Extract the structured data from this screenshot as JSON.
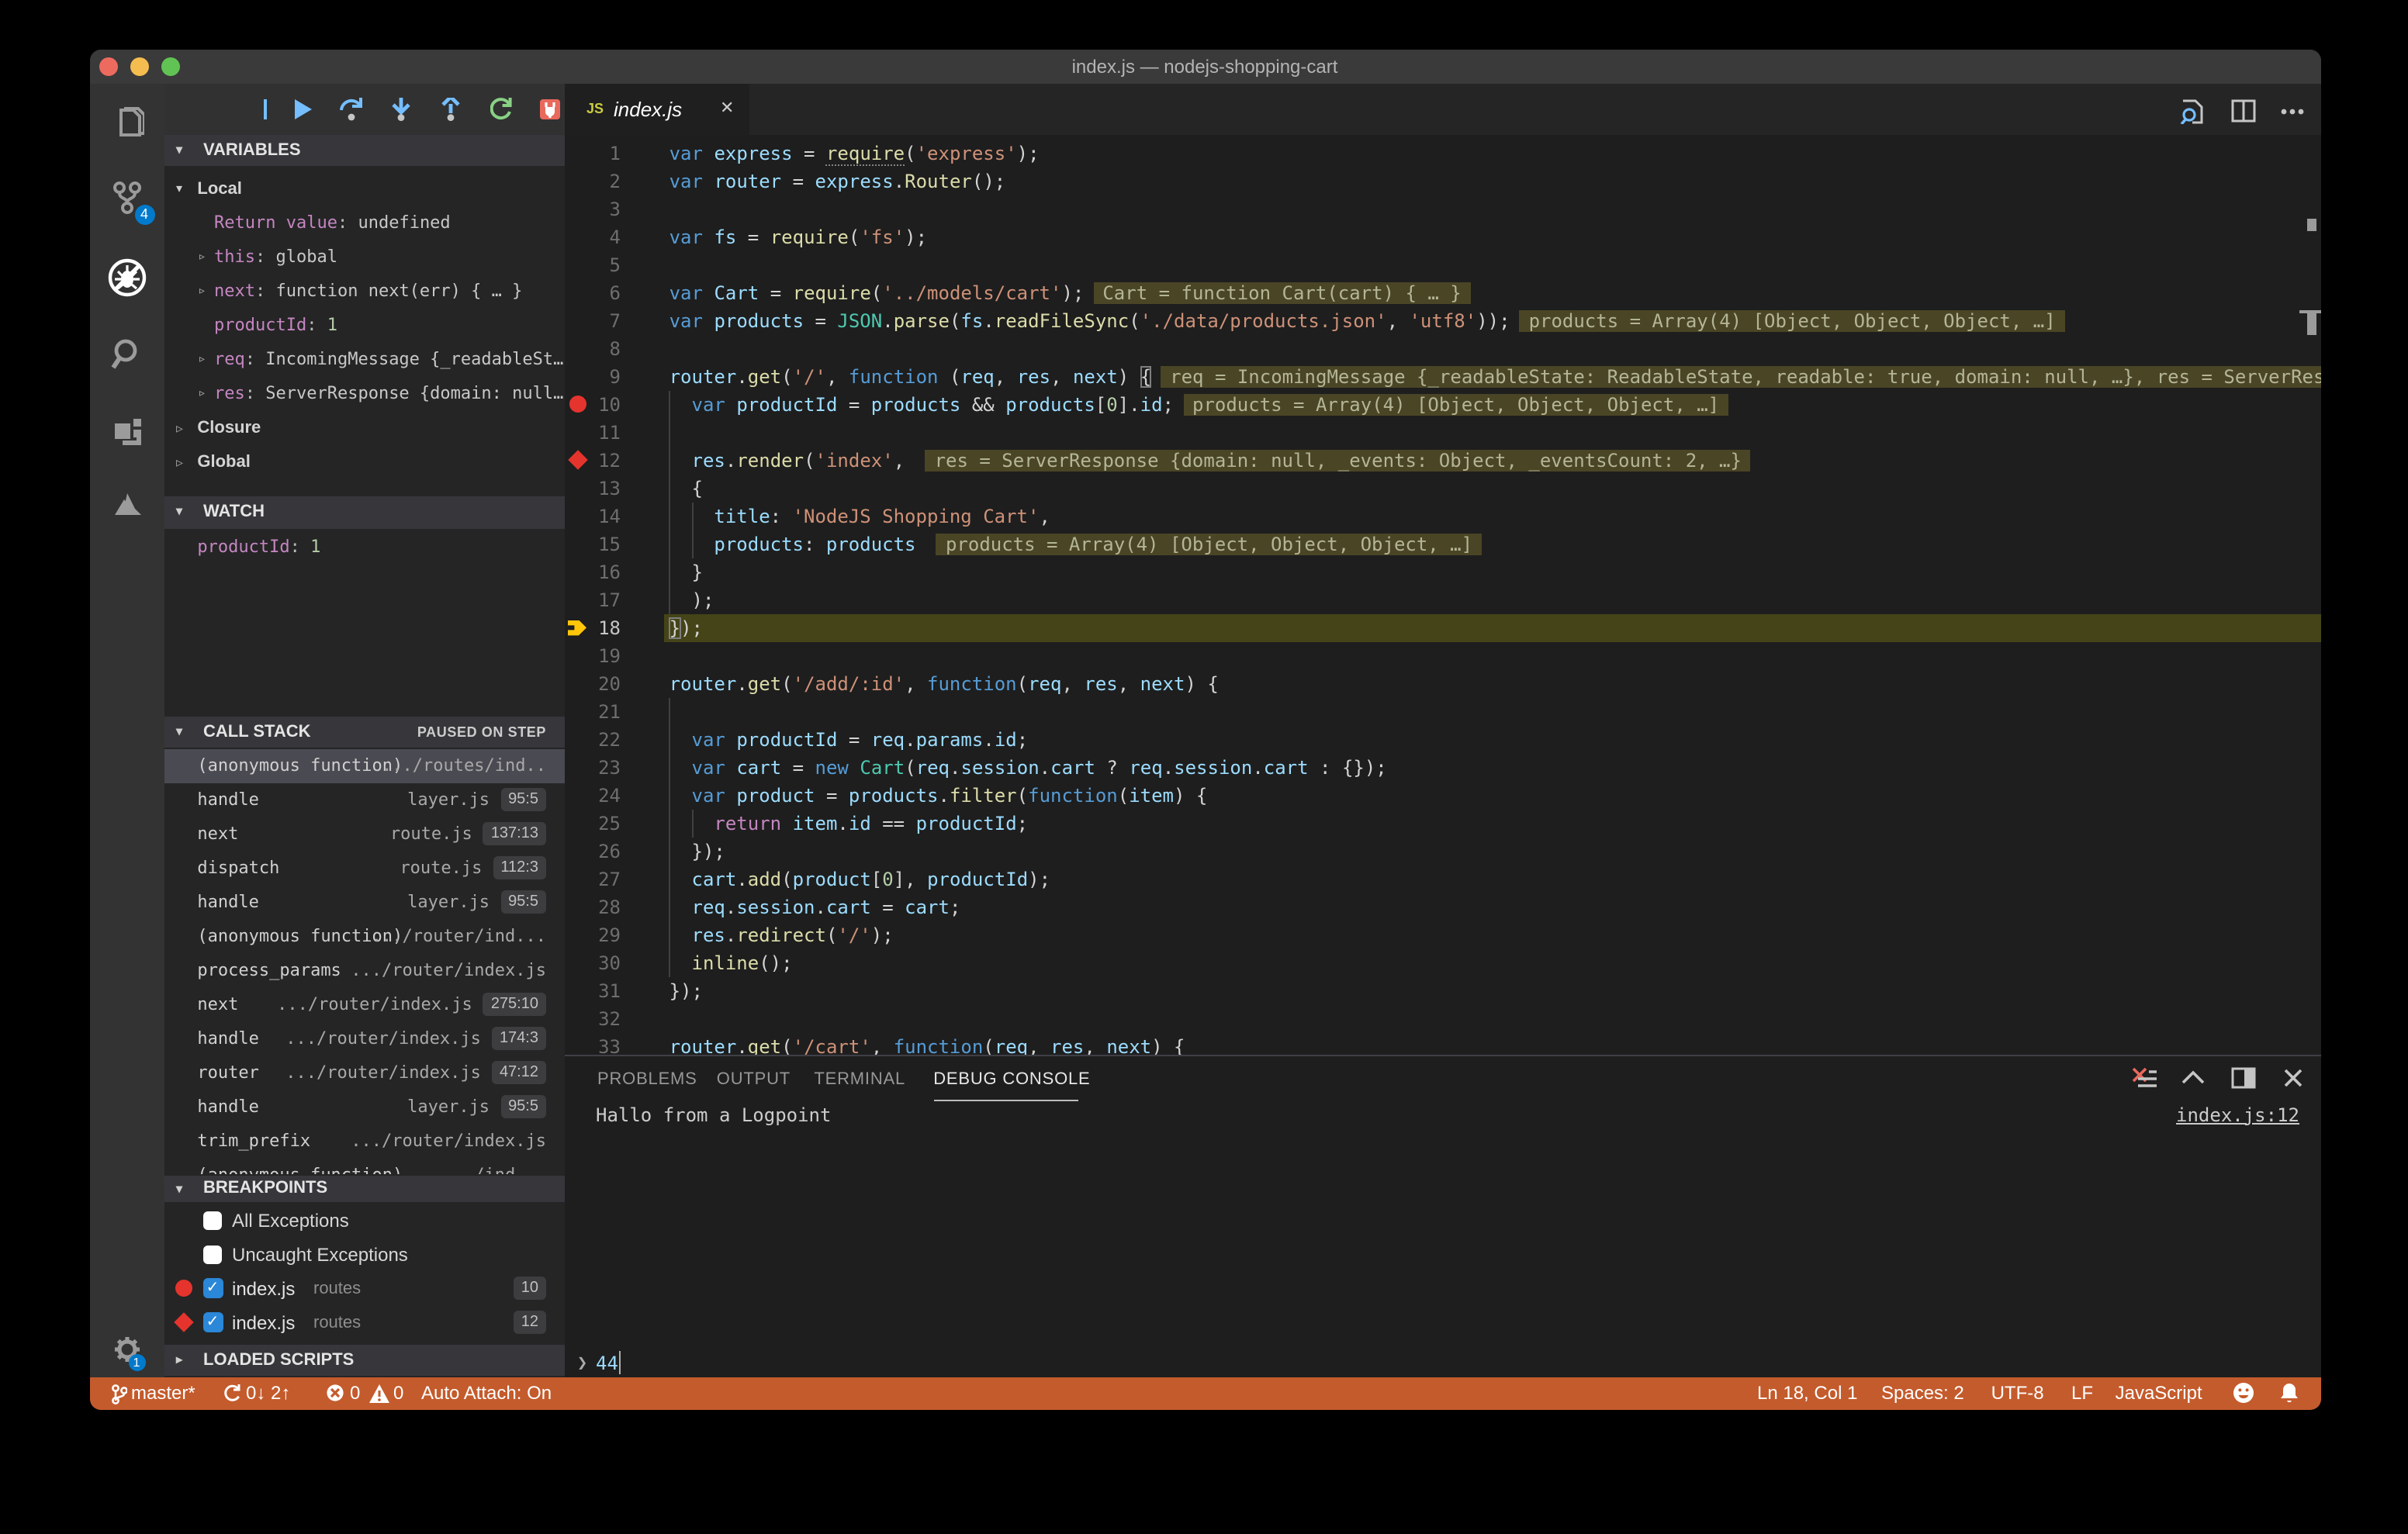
{
  "colors": {
    "status_bg": "#c45b2c",
    "accent": "#007acc",
    "breakpoint": "#e5342d",
    "current_arrow": "#ffc60a",
    "line_highlight": "#444418",
    "annotation_bg": "#4a4525"
  },
  "window": {
    "title": "index.js — nodejs-shopping-cart"
  },
  "activity_bar": {
    "scm_badge": "4",
    "settings_badge": "1"
  },
  "sidebar": {
    "variables": {
      "header": "VARIABLES",
      "scope": "Local",
      "items": [
        {
          "name": "Return value",
          "value": "undefined",
          "tw": "",
          "vc": "plain"
        },
        {
          "name": "this",
          "value": "global",
          "tw": "▹",
          "vc": "plain"
        },
        {
          "name": "next",
          "value": "function next(err) { … }",
          "tw": "▹",
          "vc": "plain"
        },
        {
          "name": "productId",
          "value": "1",
          "tw": "",
          "vc": "num"
        },
        {
          "name": "req",
          "value": "IncomingMessage {_readableSt…",
          "tw": "▹",
          "vc": "plain"
        },
        {
          "name": "res",
          "value": "ServerResponse {domain: null…",
          "tw": "▹",
          "vc": "plain"
        }
      ],
      "collapsed": [
        "Closure",
        "Global"
      ]
    },
    "watch": {
      "header": "WATCH",
      "items": [
        {
          "name": "productId",
          "value": "1"
        }
      ]
    },
    "call_stack": {
      "header": "CALL STACK",
      "status": "PAUSED ON STEP",
      "frames": [
        {
          "fn": "(anonymous function)",
          "file": ".../routes/ind..",
          "pos": "",
          "selected": true
        },
        {
          "fn": "handle",
          "file": "layer.js",
          "pos": "95:5"
        },
        {
          "fn": "next",
          "file": "route.js",
          "pos": "137:13"
        },
        {
          "fn": "dispatch",
          "file": "route.js",
          "pos": "112:3"
        },
        {
          "fn": "handle",
          "file": "layer.js",
          "pos": "95:5"
        },
        {
          "fn": "(anonymous function)",
          "file": ".../router/ind...",
          "pos": ""
        },
        {
          "fn": "process_params",
          "file": ".../router/index.js",
          "pos": ""
        },
        {
          "fn": "next",
          "file": ".../router/index.js",
          "pos": "275:10"
        },
        {
          "fn": "handle",
          "file": ".../router/index.js",
          "pos": "174:3"
        },
        {
          "fn": "router",
          "file": ".../router/index.js",
          "pos": "47:12"
        },
        {
          "fn": "handle",
          "file": "layer.js",
          "pos": "95:5"
        },
        {
          "fn": "trim_prefix",
          "file": ".../router/index.js",
          "pos": ""
        },
        {
          "fn": "(anonymous function)",
          "file": ".../ind...",
          "pos": ""
        }
      ]
    },
    "breakpoints": {
      "header": "BREAKPOINTS",
      "exceptions": [
        "All Exceptions",
        "Uncaught Exceptions"
      ],
      "items": [
        {
          "icon": "circle",
          "file": "index.js",
          "folder": "routes",
          "line": "10"
        },
        {
          "icon": "diamond",
          "file": "index.js",
          "folder": "routes",
          "line": "12"
        }
      ]
    },
    "loaded_scripts": {
      "header": "LOADED SCRIPTS"
    }
  },
  "editor": {
    "tab": {
      "icon": "JS",
      "name": "index.js",
      "close": "✕"
    },
    "current_line": 18,
    "gutter": {
      "10": "circle",
      "12": "diamond",
      "18": "arrow"
    },
    "annotations": {
      "6": "Cart = function Cart(cart) { … }",
      "7": "products = Array(4) [Object, Object, Object, …]",
      "9": "req = IncomingMessage {_readableState: ReadableState, readable: true, domain: null, …}, res = ServerResponse {domain: n",
      "10": "products = Array(4) [Object, Object, Object, …]",
      "12": "res = ServerResponse {domain: null, _events: Object, _eventsCount: 2, …}",
      "15": "products = Array(4) [Object, Object, Object, …]"
    },
    "lines": [
      {
        "n": 1,
        "t": [
          [
            "k",
            "var"
          ],
          [
            "p",
            " "
          ],
          [
            "i",
            "express"
          ],
          [
            "p",
            " = "
          ],
          [
            "u",
            "require"
          ],
          [
            "p",
            "("
          ],
          [
            "s",
            "'express'"
          ],
          [
            "p",
            ");"
          ]
        ]
      },
      {
        "n": 2,
        "t": [
          [
            "k",
            "var"
          ],
          [
            "p",
            " "
          ],
          [
            "i",
            "router"
          ],
          [
            "p",
            " = "
          ],
          [
            "i",
            "express"
          ],
          [
            "p",
            "."
          ],
          [
            "f",
            "Router"
          ],
          [
            "p",
            "();"
          ]
        ]
      },
      {
        "n": 3,
        "t": []
      },
      {
        "n": 4,
        "t": [
          [
            "k",
            "var"
          ],
          [
            "p",
            " "
          ],
          [
            "i",
            "fs"
          ],
          [
            "p",
            " = "
          ],
          [
            "f",
            "require"
          ],
          [
            "p",
            "("
          ],
          [
            "s",
            "'fs'"
          ],
          [
            "p",
            ");"
          ]
        ]
      },
      {
        "n": 5,
        "t": []
      },
      {
        "n": 6,
        "t": [
          [
            "k",
            "var"
          ],
          [
            "p",
            " "
          ],
          [
            "i",
            "Cart"
          ],
          [
            "p",
            " = "
          ],
          [
            "f",
            "require"
          ],
          [
            "p",
            "("
          ],
          [
            "s",
            "'../models/cart'"
          ],
          [
            "p",
            ");"
          ]
        ]
      },
      {
        "n": 7,
        "t": [
          [
            "k",
            "var"
          ],
          [
            "p",
            " "
          ],
          [
            "i",
            "products"
          ],
          [
            "p",
            " = "
          ],
          [
            "t",
            "JSON"
          ],
          [
            "p",
            "."
          ],
          [
            "f",
            "parse"
          ],
          [
            "p",
            "("
          ],
          [
            "i",
            "fs"
          ],
          [
            "p",
            "."
          ],
          [
            "f",
            "readFileSync"
          ],
          [
            "p",
            "("
          ],
          [
            "s",
            "'./data/products.json'"
          ],
          [
            "p",
            ", "
          ],
          [
            "s",
            "'utf8'"
          ],
          [
            "p",
            "));"
          ]
        ]
      },
      {
        "n": 8,
        "t": []
      },
      {
        "n": 9,
        "t": [
          [
            "i",
            "router"
          ],
          [
            "p",
            "."
          ],
          [
            "f",
            "get"
          ],
          [
            "p",
            "("
          ],
          [
            "s",
            "'/'"
          ],
          [
            "p",
            ", "
          ],
          [
            "k",
            "function"
          ],
          [
            "p",
            " ("
          ],
          [
            "i",
            "req"
          ],
          [
            "p",
            ", "
          ],
          [
            "i",
            "res"
          ],
          [
            "p",
            ", "
          ],
          [
            "i",
            "next"
          ],
          [
            "p",
            ") "
          ],
          [
            "b",
            "{"
          ]
        ]
      },
      {
        "n": 10,
        "t": [
          [
            "p",
            "  "
          ],
          [
            "k",
            "var"
          ],
          [
            "p",
            " "
          ],
          [
            "i",
            "productId"
          ],
          [
            "p",
            " = "
          ],
          [
            "i",
            "products"
          ],
          [
            "p",
            " && "
          ],
          [
            "i",
            "products"
          ],
          [
            "p",
            "["
          ],
          [
            "n",
            "0"
          ],
          [
            "p",
            "]."
          ],
          [
            "i",
            "id"
          ],
          [
            "p",
            ";"
          ]
        ]
      },
      {
        "n": 11,
        "t": []
      },
      {
        "n": 12,
        "t": [
          [
            "p",
            "  "
          ],
          [
            "i",
            "res"
          ],
          [
            "p",
            "."
          ],
          [
            "f",
            "render"
          ],
          [
            "p",
            "("
          ],
          [
            "s",
            "'index'"
          ],
          [
            "p",
            ", "
          ]
        ]
      },
      {
        "n": 13,
        "t": [
          [
            "p",
            "  {"
          ]
        ]
      },
      {
        "n": 14,
        "t": [
          [
            "p",
            "    "
          ],
          [
            "i",
            "title"
          ],
          [
            "p",
            ": "
          ],
          [
            "s",
            "'NodeJS Shopping Cart'"
          ],
          [
            "p",
            ","
          ]
        ]
      },
      {
        "n": 15,
        "t": [
          [
            "p",
            "    "
          ],
          [
            "i",
            "products"
          ],
          [
            "p",
            ": "
          ],
          [
            "i",
            "products"
          ],
          [
            "p",
            " "
          ]
        ]
      },
      {
        "n": 16,
        "t": [
          [
            "p",
            "  }"
          ]
        ]
      },
      {
        "n": 17,
        "t": [
          [
            "p",
            "  );"
          ]
        ]
      },
      {
        "n": 18,
        "t": [
          [
            "b",
            "}"
          ],
          [
            "p",
            ");"
          ]
        ]
      },
      {
        "n": 19,
        "t": []
      },
      {
        "n": 20,
        "t": [
          [
            "i",
            "router"
          ],
          [
            "p",
            "."
          ],
          [
            "f",
            "get"
          ],
          [
            "p",
            "("
          ],
          [
            "s",
            "'/add/:id'"
          ],
          [
            "p",
            ", "
          ],
          [
            "k",
            "function"
          ],
          [
            "p",
            "("
          ],
          [
            "i",
            "req"
          ],
          [
            "p",
            ", "
          ],
          [
            "i",
            "res"
          ],
          [
            "p",
            ", "
          ],
          [
            "i",
            "next"
          ],
          [
            "p",
            ") {"
          ]
        ]
      },
      {
        "n": 21,
        "t": []
      },
      {
        "n": 22,
        "t": [
          [
            "p",
            "  "
          ],
          [
            "k",
            "var"
          ],
          [
            "p",
            " "
          ],
          [
            "i",
            "productId"
          ],
          [
            "p",
            " = "
          ],
          [
            "i",
            "req"
          ],
          [
            "p",
            "."
          ],
          [
            "i",
            "params"
          ],
          [
            "p",
            "."
          ],
          [
            "i",
            "id"
          ],
          [
            "p",
            ";"
          ]
        ]
      },
      {
        "n": 23,
        "t": [
          [
            "p",
            "  "
          ],
          [
            "k",
            "var"
          ],
          [
            "p",
            " "
          ],
          [
            "i",
            "cart"
          ],
          [
            "p",
            " = "
          ],
          [
            "k",
            "new"
          ],
          [
            "p",
            " "
          ],
          [
            "t",
            "Cart"
          ],
          [
            "p",
            "("
          ],
          [
            "i",
            "req"
          ],
          [
            "p",
            "."
          ],
          [
            "i",
            "session"
          ],
          [
            "p",
            "."
          ],
          [
            "i",
            "cart"
          ],
          [
            "p",
            " ? "
          ],
          [
            "i",
            "req"
          ],
          [
            "p",
            "."
          ],
          [
            "i",
            "session"
          ],
          [
            "p",
            "."
          ],
          [
            "i",
            "cart"
          ],
          [
            "p",
            " : {});"
          ]
        ]
      },
      {
        "n": 24,
        "t": [
          [
            "p",
            "  "
          ],
          [
            "k",
            "var"
          ],
          [
            "p",
            " "
          ],
          [
            "i",
            "product"
          ],
          [
            "p",
            " = "
          ],
          [
            "i",
            "products"
          ],
          [
            "p",
            "."
          ],
          [
            "f",
            "filter"
          ],
          [
            "p",
            "("
          ],
          [
            "k",
            "function"
          ],
          [
            "p",
            "("
          ],
          [
            "i",
            "item"
          ],
          [
            "p",
            ") {"
          ]
        ]
      },
      {
        "n": 25,
        "t": [
          [
            "p",
            "    "
          ],
          [
            "w",
            "return"
          ],
          [
            "p",
            " "
          ],
          [
            "i",
            "item"
          ],
          [
            "p",
            "."
          ],
          [
            "i",
            "id"
          ],
          [
            "p",
            " == "
          ],
          [
            "i",
            "productId"
          ],
          [
            "p",
            ";"
          ]
        ]
      },
      {
        "n": 26,
        "t": [
          [
            "p",
            "  });"
          ]
        ]
      },
      {
        "n": 27,
        "t": [
          [
            "p",
            "  "
          ],
          [
            "i",
            "cart"
          ],
          [
            "p",
            "."
          ],
          [
            "f",
            "add"
          ],
          [
            "p",
            "("
          ],
          [
            "i",
            "product"
          ],
          [
            "p",
            "["
          ],
          [
            "n",
            "0"
          ],
          [
            "p",
            "], "
          ],
          [
            "i",
            "productId"
          ],
          [
            "p",
            ");"
          ]
        ]
      },
      {
        "n": 28,
        "t": [
          [
            "p",
            "  "
          ],
          [
            "i",
            "req"
          ],
          [
            "p",
            "."
          ],
          [
            "i",
            "session"
          ],
          [
            "p",
            "."
          ],
          [
            "i",
            "cart"
          ],
          [
            "p",
            " = "
          ],
          [
            "i",
            "cart"
          ],
          [
            "p",
            ";"
          ]
        ]
      },
      {
        "n": 29,
        "t": [
          [
            "p",
            "  "
          ],
          [
            "i",
            "res"
          ],
          [
            "p",
            "."
          ],
          [
            "f",
            "redirect"
          ],
          [
            "p",
            "("
          ],
          [
            "s",
            "'/'"
          ],
          [
            "p",
            ");"
          ]
        ]
      },
      {
        "n": 30,
        "t": [
          [
            "p",
            "  "
          ],
          [
            "f",
            "inline"
          ],
          [
            "p",
            "();"
          ]
        ]
      },
      {
        "n": 31,
        "t": [
          [
            "p",
            "});"
          ]
        ]
      },
      {
        "n": 32,
        "t": []
      },
      {
        "n": 33,
        "t": [
          [
            "i",
            "router"
          ],
          [
            "p",
            "."
          ],
          [
            "f",
            "get"
          ],
          [
            "p",
            "("
          ],
          [
            "s",
            "'/cart'"
          ],
          [
            "p",
            ", "
          ],
          [
            "k",
            "function"
          ],
          [
            "p",
            "("
          ],
          [
            "i",
            "req"
          ],
          [
            "p",
            ", "
          ],
          [
            "i",
            "res"
          ],
          [
            "p",
            ", "
          ],
          [
            "i",
            "next"
          ],
          [
            "p",
            ") {"
          ]
        ]
      }
    ]
  },
  "panel": {
    "tabs": [
      "PROBLEMS",
      "OUTPUT",
      "TERMINAL",
      "DEBUG CONSOLE"
    ],
    "active_tab": "DEBUG CONSOLE",
    "link": "index.js:12",
    "output": "Hallo from a Logpoint",
    "prompt_value": "44"
  },
  "status_bar": {
    "branch": "master*",
    "sync": "0↓ 2↑",
    "errors": "0",
    "warnings": "0",
    "auto_attach": "Auto Attach: On",
    "ln_col": "Ln 18, Col 1",
    "spaces": "Spaces: 2",
    "encoding": "UTF-8",
    "eol": "LF",
    "language": "JavaScript"
  }
}
